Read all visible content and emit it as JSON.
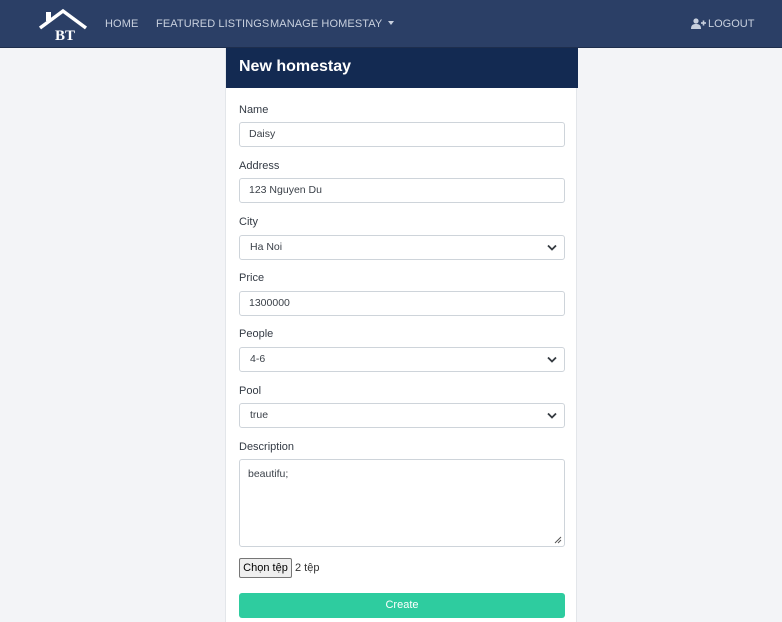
{
  "nav": {
    "logo_text": "BT",
    "home": "HOME",
    "featured": "FEATURED LISTINGS",
    "manage": "MANAGE HOMESTAY",
    "logout": "LOGOUT"
  },
  "form": {
    "title": "New homestay",
    "name_label": "Name",
    "name_value": "Daisy",
    "address_label": "Address",
    "address_value": "123 Nguyen Du",
    "city_label": "City",
    "city_value": "Ha Noi",
    "price_label": "Price",
    "price_value": "1300000",
    "people_label": "People",
    "people_value": "4-6",
    "pool_label": "Pool",
    "pool_value": "true",
    "description_label": "Description",
    "description_value": "beautifu;",
    "file_button": "Chọn tệp",
    "file_status": "2 tệp",
    "submit": "Create"
  },
  "colors": {
    "navbar": "#2b3f66",
    "card_header": "#132a52",
    "submit": "#2ecc9f"
  }
}
